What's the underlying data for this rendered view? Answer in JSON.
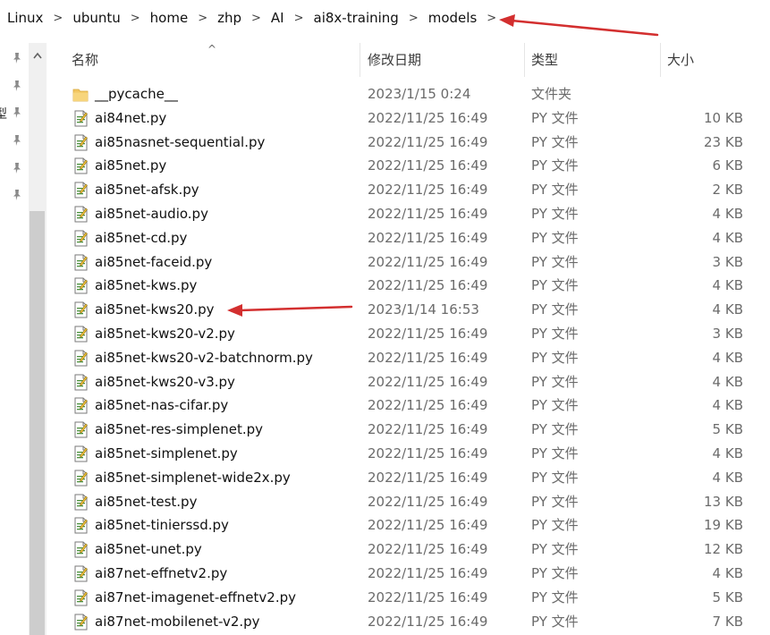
{
  "breadcrumb": [
    "Linux",
    "ubuntu",
    "home",
    "zhp",
    "AI",
    "ai8x-training",
    "models"
  ],
  "left_panel": {
    "cut_label": "型"
  },
  "headers": {
    "name": "名称",
    "date": "修改日期",
    "type": "类型",
    "size": "大小"
  },
  "colors": {
    "folder": "#f2c661",
    "annotation_arrow": "#d32f2f",
    "scroll_thumb": "#cdcdcd"
  },
  "files": [
    {
      "icon": "folder-icon",
      "name": "__pycache__",
      "date": "2023/1/15 0:24",
      "type": "文件夹",
      "size": ""
    },
    {
      "icon": "python-file-icon",
      "name": "ai84net.py",
      "date": "2022/11/25 16:49",
      "type": "PY 文件",
      "size": "10 KB"
    },
    {
      "icon": "python-file-icon",
      "name": "ai85nasnet-sequential.py",
      "date": "2022/11/25 16:49",
      "type": "PY 文件",
      "size": "23 KB"
    },
    {
      "icon": "python-file-icon",
      "name": "ai85net.py",
      "date": "2022/11/25 16:49",
      "type": "PY 文件",
      "size": "6 KB"
    },
    {
      "icon": "python-file-icon",
      "name": "ai85net-afsk.py",
      "date": "2022/11/25 16:49",
      "type": "PY 文件",
      "size": "2 KB"
    },
    {
      "icon": "python-file-icon",
      "name": "ai85net-audio.py",
      "date": "2022/11/25 16:49",
      "type": "PY 文件",
      "size": "4 KB"
    },
    {
      "icon": "python-file-icon",
      "name": "ai85net-cd.py",
      "date": "2022/11/25 16:49",
      "type": "PY 文件",
      "size": "4 KB"
    },
    {
      "icon": "python-file-icon",
      "name": "ai85net-faceid.py",
      "date": "2022/11/25 16:49",
      "type": "PY 文件",
      "size": "3 KB"
    },
    {
      "icon": "python-file-icon",
      "name": "ai85net-kws.py",
      "date": "2022/11/25 16:49",
      "type": "PY 文件",
      "size": "4 KB"
    },
    {
      "icon": "python-file-icon",
      "name": "ai85net-kws20.py",
      "date": "2023/1/14 16:53",
      "type": "PY 文件",
      "size": "4 KB"
    },
    {
      "icon": "python-file-icon",
      "name": "ai85net-kws20-v2.py",
      "date": "2022/11/25 16:49",
      "type": "PY 文件",
      "size": "3 KB"
    },
    {
      "icon": "python-file-icon",
      "name": "ai85net-kws20-v2-batchnorm.py",
      "date": "2022/11/25 16:49",
      "type": "PY 文件",
      "size": "4 KB"
    },
    {
      "icon": "python-file-icon",
      "name": "ai85net-kws20-v3.py",
      "date": "2022/11/25 16:49",
      "type": "PY 文件",
      "size": "4 KB"
    },
    {
      "icon": "python-file-icon",
      "name": "ai85net-nas-cifar.py",
      "date": "2022/11/25 16:49",
      "type": "PY 文件",
      "size": "4 KB"
    },
    {
      "icon": "python-file-icon",
      "name": "ai85net-res-simplenet.py",
      "date": "2022/11/25 16:49",
      "type": "PY 文件",
      "size": "5 KB"
    },
    {
      "icon": "python-file-icon",
      "name": "ai85net-simplenet.py",
      "date": "2022/11/25 16:49",
      "type": "PY 文件",
      "size": "4 KB"
    },
    {
      "icon": "python-file-icon",
      "name": "ai85net-simplenet-wide2x.py",
      "date": "2022/11/25 16:49",
      "type": "PY 文件",
      "size": "4 KB"
    },
    {
      "icon": "python-file-icon",
      "name": "ai85net-test.py",
      "date": "2022/11/25 16:49",
      "type": "PY 文件",
      "size": "13 KB"
    },
    {
      "icon": "python-file-icon",
      "name": "ai85net-tinierssd.py",
      "date": "2022/11/25 16:49",
      "type": "PY 文件",
      "size": "19 KB"
    },
    {
      "icon": "python-file-icon",
      "name": "ai85net-unet.py",
      "date": "2022/11/25 16:49",
      "type": "PY 文件",
      "size": "12 KB"
    },
    {
      "icon": "python-file-icon",
      "name": "ai87net-effnetv2.py",
      "date": "2022/11/25 16:49",
      "type": "PY 文件",
      "size": "4 KB"
    },
    {
      "icon": "python-file-icon",
      "name": "ai87net-imagenet-effnetv2.py",
      "date": "2022/11/25 16:49",
      "type": "PY 文件",
      "size": "5 KB"
    },
    {
      "icon": "python-file-icon",
      "name": "ai87net-mobilenet-v2.py",
      "date": "2022/11/25 16:49",
      "type": "PY 文件",
      "size": "7 KB"
    }
  ]
}
